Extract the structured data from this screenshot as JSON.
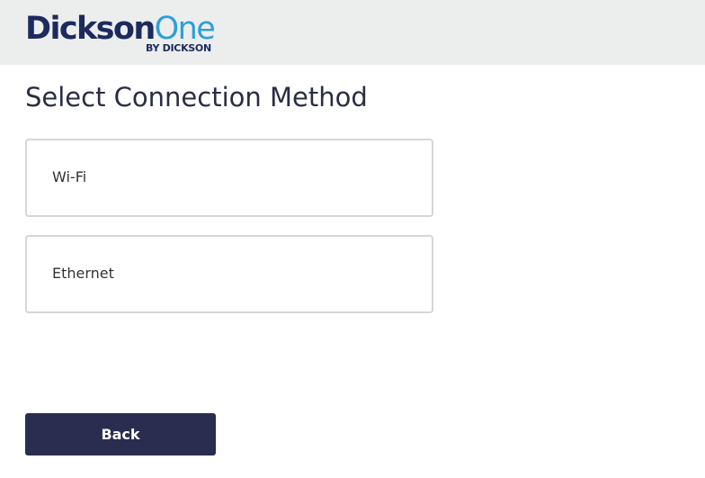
{
  "header": {
    "logo": {
      "brand_primary": "Dickson",
      "brand_secondary": "One",
      "tagline": "BY DICKSON"
    }
  },
  "main": {
    "title": "Select Connection Method",
    "options": [
      {
        "label": "Wi-Fi"
      },
      {
        "label": "Ethernet"
      }
    ]
  },
  "footer": {
    "back_label": "Back"
  },
  "colors": {
    "brand_navy": "#1c2a5e",
    "brand_blue": "#2d9fd9",
    "header_bg": "#eceeee",
    "button_bg": "#2a2d4f"
  }
}
